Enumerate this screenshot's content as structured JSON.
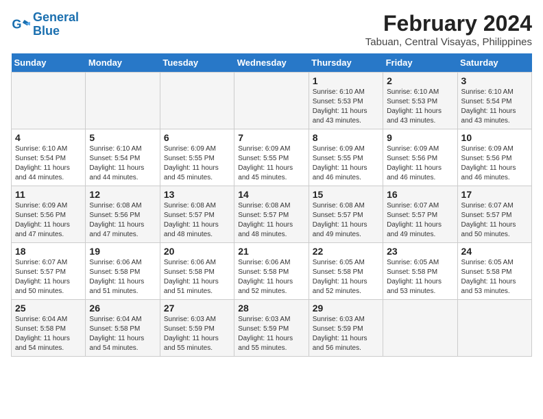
{
  "header": {
    "logo_line1": "General",
    "logo_line2": "Blue",
    "month": "February 2024",
    "location": "Tabuan, Central Visayas, Philippines"
  },
  "weekdays": [
    "Sunday",
    "Monday",
    "Tuesday",
    "Wednesday",
    "Thursday",
    "Friday",
    "Saturday"
  ],
  "weeks": [
    [
      {
        "day": "",
        "info": ""
      },
      {
        "day": "",
        "info": ""
      },
      {
        "day": "",
        "info": ""
      },
      {
        "day": "",
        "info": ""
      },
      {
        "day": "1",
        "info": "Sunrise: 6:10 AM\nSunset: 5:53 PM\nDaylight: 11 hours\nand 43 minutes."
      },
      {
        "day": "2",
        "info": "Sunrise: 6:10 AM\nSunset: 5:53 PM\nDaylight: 11 hours\nand 43 minutes."
      },
      {
        "day": "3",
        "info": "Sunrise: 6:10 AM\nSunset: 5:54 PM\nDaylight: 11 hours\nand 43 minutes."
      }
    ],
    [
      {
        "day": "4",
        "info": "Sunrise: 6:10 AM\nSunset: 5:54 PM\nDaylight: 11 hours\nand 44 minutes."
      },
      {
        "day": "5",
        "info": "Sunrise: 6:10 AM\nSunset: 5:54 PM\nDaylight: 11 hours\nand 44 minutes."
      },
      {
        "day": "6",
        "info": "Sunrise: 6:09 AM\nSunset: 5:55 PM\nDaylight: 11 hours\nand 45 minutes."
      },
      {
        "day": "7",
        "info": "Sunrise: 6:09 AM\nSunset: 5:55 PM\nDaylight: 11 hours\nand 45 minutes."
      },
      {
        "day": "8",
        "info": "Sunrise: 6:09 AM\nSunset: 5:55 PM\nDaylight: 11 hours\nand 46 minutes."
      },
      {
        "day": "9",
        "info": "Sunrise: 6:09 AM\nSunset: 5:56 PM\nDaylight: 11 hours\nand 46 minutes."
      },
      {
        "day": "10",
        "info": "Sunrise: 6:09 AM\nSunset: 5:56 PM\nDaylight: 11 hours\nand 46 minutes."
      }
    ],
    [
      {
        "day": "11",
        "info": "Sunrise: 6:09 AM\nSunset: 5:56 PM\nDaylight: 11 hours\nand 47 minutes."
      },
      {
        "day": "12",
        "info": "Sunrise: 6:08 AM\nSunset: 5:56 PM\nDaylight: 11 hours\nand 47 minutes."
      },
      {
        "day": "13",
        "info": "Sunrise: 6:08 AM\nSunset: 5:57 PM\nDaylight: 11 hours\nand 48 minutes."
      },
      {
        "day": "14",
        "info": "Sunrise: 6:08 AM\nSunset: 5:57 PM\nDaylight: 11 hours\nand 48 minutes."
      },
      {
        "day": "15",
        "info": "Sunrise: 6:08 AM\nSunset: 5:57 PM\nDaylight: 11 hours\nand 49 minutes."
      },
      {
        "day": "16",
        "info": "Sunrise: 6:07 AM\nSunset: 5:57 PM\nDaylight: 11 hours\nand 49 minutes."
      },
      {
        "day": "17",
        "info": "Sunrise: 6:07 AM\nSunset: 5:57 PM\nDaylight: 11 hours\nand 50 minutes."
      }
    ],
    [
      {
        "day": "18",
        "info": "Sunrise: 6:07 AM\nSunset: 5:57 PM\nDaylight: 11 hours\nand 50 minutes."
      },
      {
        "day": "19",
        "info": "Sunrise: 6:06 AM\nSunset: 5:58 PM\nDaylight: 11 hours\nand 51 minutes."
      },
      {
        "day": "20",
        "info": "Sunrise: 6:06 AM\nSunset: 5:58 PM\nDaylight: 11 hours\nand 51 minutes."
      },
      {
        "day": "21",
        "info": "Sunrise: 6:06 AM\nSunset: 5:58 PM\nDaylight: 11 hours\nand 52 minutes."
      },
      {
        "day": "22",
        "info": "Sunrise: 6:05 AM\nSunset: 5:58 PM\nDaylight: 11 hours\nand 52 minutes."
      },
      {
        "day": "23",
        "info": "Sunrise: 6:05 AM\nSunset: 5:58 PM\nDaylight: 11 hours\nand 53 minutes."
      },
      {
        "day": "24",
        "info": "Sunrise: 6:05 AM\nSunset: 5:58 PM\nDaylight: 11 hours\nand 53 minutes."
      }
    ],
    [
      {
        "day": "25",
        "info": "Sunrise: 6:04 AM\nSunset: 5:58 PM\nDaylight: 11 hours\nand 54 minutes."
      },
      {
        "day": "26",
        "info": "Sunrise: 6:04 AM\nSunset: 5:58 PM\nDaylight: 11 hours\nand 54 minutes."
      },
      {
        "day": "27",
        "info": "Sunrise: 6:03 AM\nSunset: 5:59 PM\nDaylight: 11 hours\nand 55 minutes."
      },
      {
        "day": "28",
        "info": "Sunrise: 6:03 AM\nSunset: 5:59 PM\nDaylight: 11 hours\nand 55 minutes."
      },
      {
        "day": "29",
        "info": "Sunrise: 6:03 AM\nSunset: 5:59 PM\nDaylight: 11 hours\nand 56 minutes."
      },
      {
        "day": "",
        "info": ""
      },
      {
        "day": "",
        "info": ""
      }
    ]
  ]
}
